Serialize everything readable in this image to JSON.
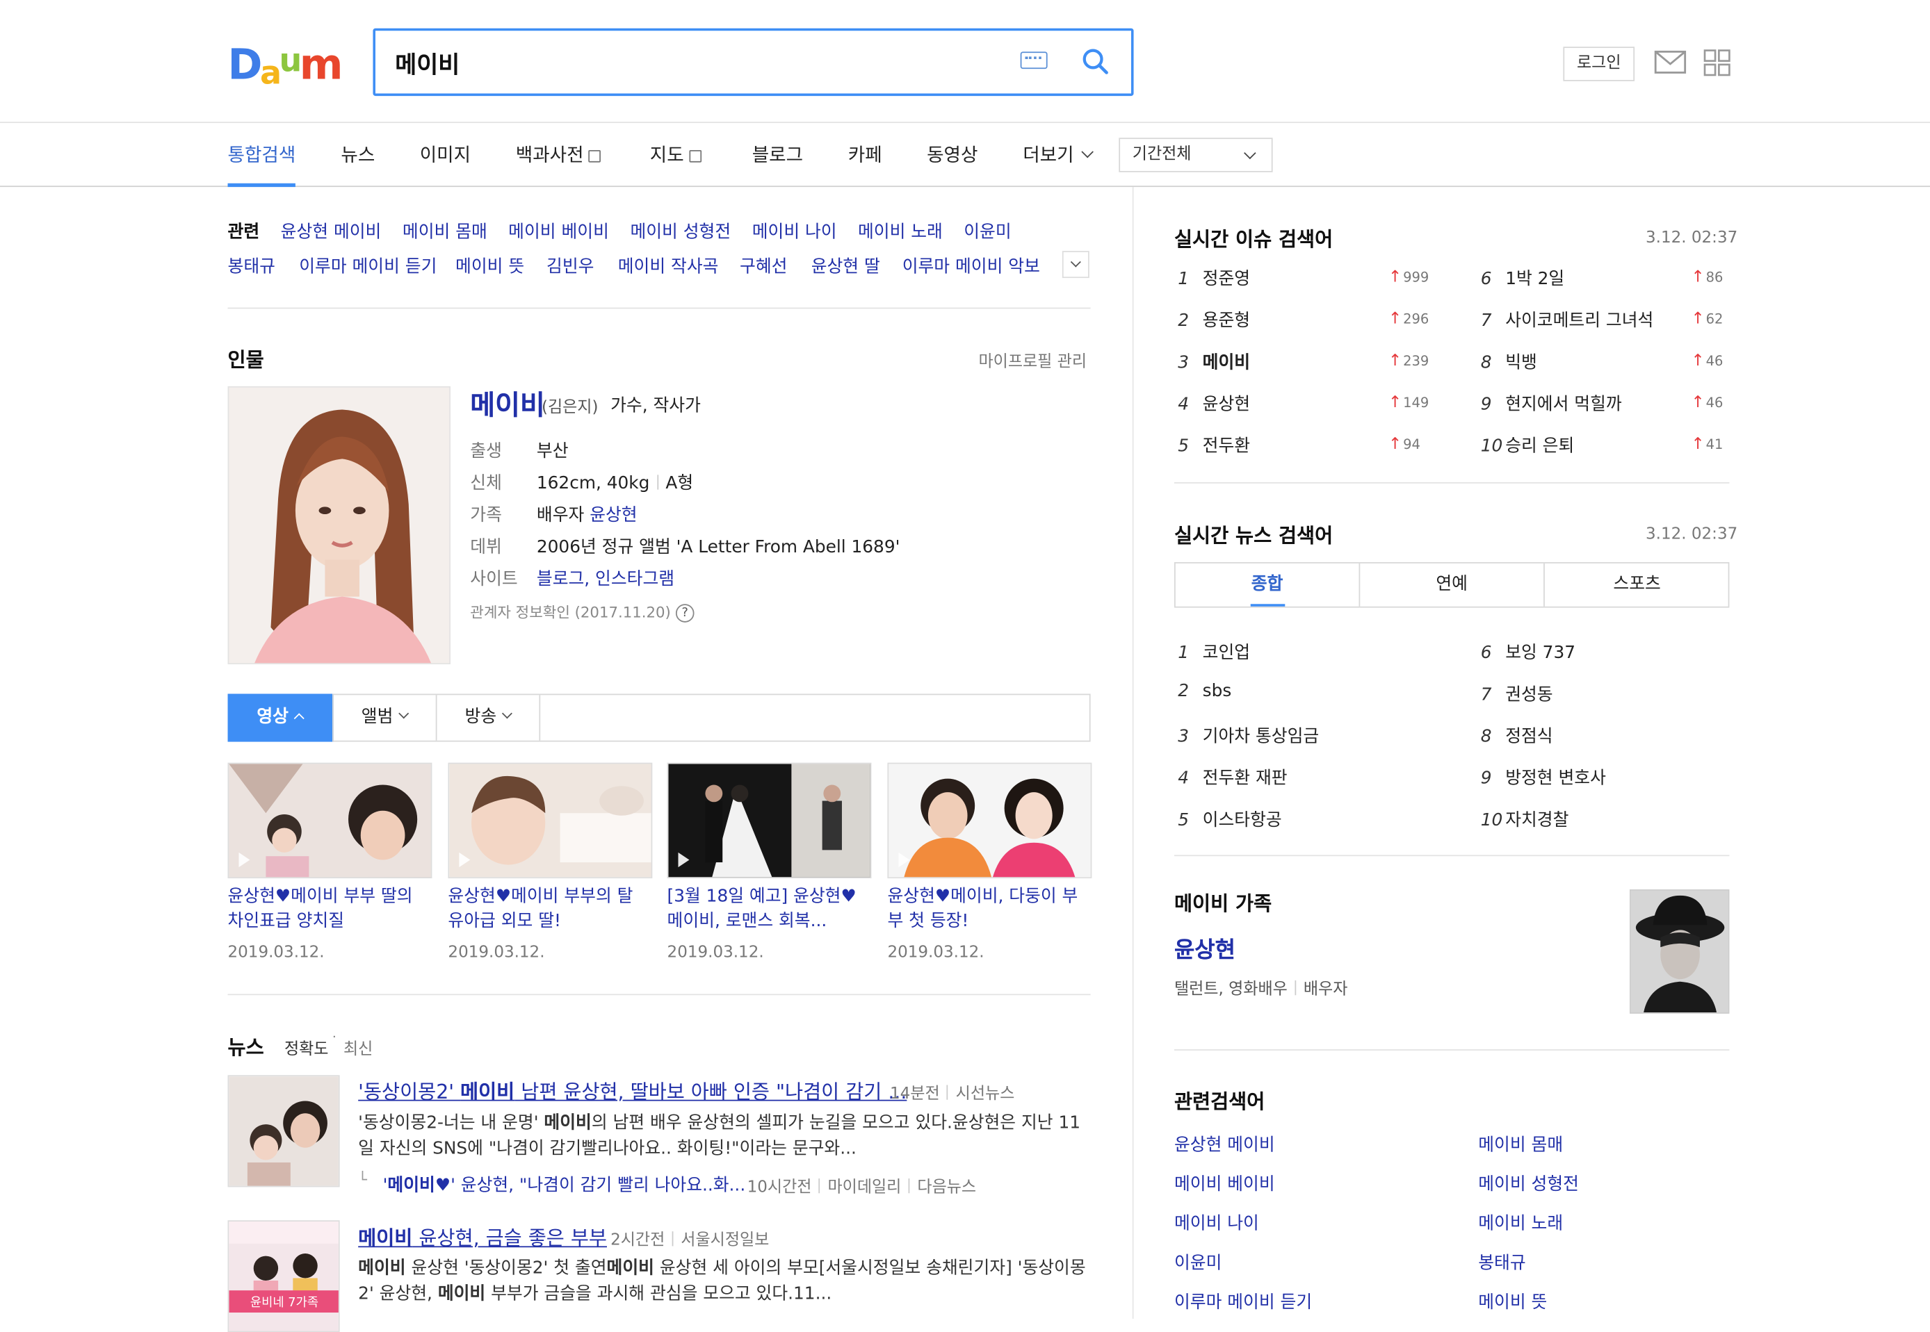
{
  "brand": {
    "logo": "Daum"
  },
  "search": {
    "query": "메이비"
  },
  "header": {
    "login_label": "로그인"
  },
  "nav": {
    "tabs": [
      "통합검색",
      "뉴스",
      "이미지",
      "백과사전",
      "지도",
      "블로그",
      "카페",
      "동영상",
      "더보기"
    ],
    "period": "기간전체"
  },
  "related_top": {
    "label": "관련",
    "items": [
      "윤상현 메이비",
      "메이비 몸매",
      "메이비 베이비",
      "메이비 성형전",
      "메이비 나이",
      "메이비 노래",
      "이윤미",
      "봉태규",
      "이루마 메이비 듣기",
      "메이비 뜻",
      "김빈우",
      "메이비 작사곡",
      "구혜선",
      "윤상현 딸",
      "이루마 메이비 악보"
    ]
  },
  "person": {
    "section_title": "인물",
    "manage_link": "마이프로필 관리",
    "name": "메이비",
    "real_name": "(김은지)",
    "occupation": "가수, 작사가",
    "rows": [
      {
        "k": "출생",
        "v": "부산"
      },
      {
        "k": "신체",
        "v": "162cm, 40kg",
        "v2": "A형"
      },
      {
        "k": "가족",
        "v": "배우자 ",
        "link": "윤상현"
      },
      {
        "k": "데뷔",
        "v": "2006년 정규 앨범 'A Letter From Abell 1689'"
      },
      {
        "k": "사이트",
        "link": "블로그, 인스타그램"
      }
    ],
    "verified": "관계자 정보확인 (2017.11.20)",
    "help": "?"
  },
  "media_tabs": [
    "영상",
    "앨범",
    "방송"
  ],
  "videos": [
    {
      "title": "윤상현♥메이비 부부 딸의 차인표급 양치질",
      "date": "2019.03.12."
    },
    {
      "title": "윤상현♥메이비 부부의 탈 유아급 외모 딸!",
      "date": "2019.03.12."
    },
    {
      "title": "[3월 18일 예고] 윤상현♥메이비, 로맨스 회복...",
      "date": "2019.03.12."
    },
    {
      "title": "윤상현♥메이비, 다둥이 부부 첫 등장!",
      "date": "2019.03.12."
    }
  ],
  "news": {
    "section_title": "뉴스",
    "sort_acc": "정확도",
    "sort_new": "최신",
    "items": [
      {
        "title_pre": "'동상이몽2' ",
        "title_b": "메이비",
        "title_post": " 남편 윤상현, 딸바보 아빠 인증 \"나겸이 감기 ...",
        "time": "14분전",
        "source": "시선뉴스",
        "body_pre": "'동상이몽2-너는 내 운명' ",
        "body_b": "메이비",
        "body_post": "의 남편 배우 윤상현의 셀피가 눈길을 모으고 있다.윤상현은 지난 11일 자신의 SNS에 \"나겸이 감기빨리나아요.. 화이팅!\"이라는 문구와...",
        "sub_pre": "'",
        "sub_b": "메이비♥",
        "sub_post": "' 윤상현, \"나겸이 감기 빨리 나아요..화...",
        "sub_time": "10시간전",
        "sub_src1": "마이데일리",
        "sub_src2": "다음뉴스"
      },
      {
        "title_b": "메이비",
        "title_post": " 윤상현, 금슬 좋은 부부",
        "time": "2시간전",
        "source": "서울시정일보",
        "body_b1": "메이비",
        "body_mid1": " 윤상현 '동상이몽2' 첫 출연",
        "body_b2": "메이비",
        "body_mid2": " 윤상현 세 아이의 부모[서울시정일보 송채린기자] '동상이몽2' 윤상현, ",
        "body_b3": "메이비",
        "body_post": " 부부가 금슬을 과시해 관심을 모으고 있다.11...",
        "thumb_caption": "윤비네 7가족"
      }
    ]
  },
  "realtime_issue": {
    "title": "실시간 이슈 검색어",
    "time": "3.12. 02:37",
    "items": [
      {
        "rank": "1",
        "kw": "정준영",
        "rise": "999"
      },
      {
        "rank": "2",
        "kw": "용준형",
        "rise": "296"
      },
      {
        "rank": "3",
        "kw": "메이비",
        "rise": "239"
      },
      {
        "rank": "4",
        "kw": "윤상현",
        "rise": "149"
      },
      {
        "rank": "5",
        "kw": "전두환",
        "rise": "94"
      },
      {
        "rank": "6",
        "kw": "1박 2일",
        "rise": "86"
      },
      {
        "rank": "7",
        "kw": "사이코메트리 그녀석",
        "rise": "62"
      },
      {
        "rank": "8",
        "kw": "빅뱅",
        "rise": "46"
      },
      {
        "rank": "9",
        "kw": "현지에서 먹힐까",
        "rise": "46"
      },
      {
        "rank": "10",
        "kw": "승리 은퇴",
        "rise": "41"
      }
    ]
  },
  "realtime_news": {
    "title": "실시간 뉴스 검색어",
    "time": "3.12. 02:37",
    "tabs": [
      "종합",
      "연예",
      "스포츠"
    ],
    "items": [
      {
        "rank": "1",
        "kw": "코인업"
      },
      {
        "rank": "2",
        "kw": "sbs"
      },
      {
        "rank": "3",
        "kw": "기아차 통상임금"
      },
      {
        "rank": "4",
        "kw": "전두환 재판"
      },
      {
        "rank": "5",
        "kw": "이스타항공"
      },
      {
        "rank": "6",
        "kw": "보잉 737"
      },
      {
        "rank": "7",
        "kw": "권성동"
      },
      {
        "rank": "8",
        "kw": "정점식"
      },
      {
        "rank": "9",
        "kw": "방정현 변호사"
      },
      {
        "rank": "10",
        "kw": "자치경찰"
      }
    ]
  },
  "family": {
    "title": "메이비 가족",
    "name": "윤상현",
    "desc": "탤런트, 영화배우",
    "relation": "배우자"
  },
  "related_right": {
    "title": "관련검색어",
    "items": [
      "윤상현 메이비",
      "메이비 몸매",
      "메이비 베이비",
      "메이비 성형전",
      "메이비 나이",
      "메이비 노래",
      "이윤미",
      "봉태규",
      "이루마 메이비 듣기",
      "메이비 뜻"
    ]
  },
  "colors": {
    "accent": "#3e8ef5",
    "link": "#2130a8",
    "rise": "#e5383b"
  }
}
